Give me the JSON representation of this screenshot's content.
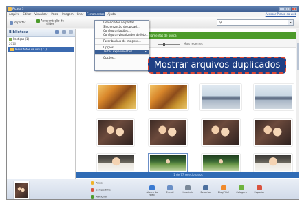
{
  "window": {
    "title": "Picasa 3",
    "controls": [
      "_",
      "□",
      "x"
    ]
  },
  "menubar": {
    "items": [
      "Arquivo",
      "Editar",
      "Visualizar",
      "Pasta",
      "Imagem",
      "Criar",
      "Ferramentas",
      "Ajuda"
    ],
    "active_index": 6,
    "right_link": "Acessar Picasa da web"
  },
  "toolbar": {
    "import_label": "Importar",
    "slideshow_label": "Apresentação de slides",
    "search_placeholder": ""
  },
  "sidebar": {
    "title": "Biblioteca",
    "items": [
      {
        "label": "Postiças (1)",
        "selected": false
      },
      {
        "label": "2010",
        "selected": false
      },
      {
        "label": "Meus fotos de usu (77)",
        "selected": true
      }
    ]
  },
  "content": {
    "green_banner": "Ferramentas de busca",
    "size_label": "Mais recentes"
  },
  "tools_menu": {
    "items": [
      {
        "label": "Gerenciador de pastas...",
        "type": "item"
      },
      {
        "label": "Sincronização de upload...",
        "type": "item"
      },
      {
        "label": "Configurar botões...",
        "type": "item"
      },
      {
        "label": "Configurar visualizador de foto...",
        "type": "item"
      },
      {
        "label": "",
        "type": "sep"
      },
      {
        "label": "Fazer backup de imagens...",
        "type": "item"
      },
      {
        "label": "",
        "type": "sep"
      },
      {
        "label": "Opções...",
        "type": "item"
      },
      {
        "label": "Testes experimentais",
        "type": "submenu",
        "highlighted": true
      },
      {
        "label": "",
        "type": "sep"
      },
      {
        "label": "Opções...",
        "type": "item"
      }
    ]
  },
  "callout": {
    "text": "Mostrar arquivos duplicados",
    "background": "#1f3f84",
    "border": "#e04a36"
  },
  "status_strip": "1 de 77 selecionados",
  "bottom": {
    "controls": [
      {
        "label": "Postar",
        "color": "#f0b32a"
      },
      {
        "label": "Compartilhar",
        "color": "#d9533f"
      },
      {
        "label": "Adicionar",
        "color": "#4c9a2a"
      }
    ],
    "buttons": [
      {
        "label": "Álbum da web",
        "icon": "globe-icon",
        "color": "#3a7ad1"
      },
      {
        "label": "E-mail",
        "icon": "envelope-icon",
        "color": "#6a8fc6"
      },
      {
        "label": "Imprimir",
        "icon": "printer-icon",
        "color": "#7a8898"
      },
      {
        "label": "Exportar",
        "icon": "export-icon",
        "color": "#4b6f9e"
      },
      {
        "label": "BlogThis!",
        "icon": "blog-icon",
        "color": "#f08a2b"
      },
      {
        "label": "Colagem",
        "icon": "collage-icon",
        "color": "#6db33f"
      },
      {
        "label": "Exportar",
        "icon": "movie-icon",
        "color": "#d9533f"
      }
    ]
  },
  "colors": {
    "accent": "#3a5f96",
    "selection": "#3b6ab0",
    "status_bar": "#2f6bb5",
    "banner_green": "#4c9a2a"
  }
}
